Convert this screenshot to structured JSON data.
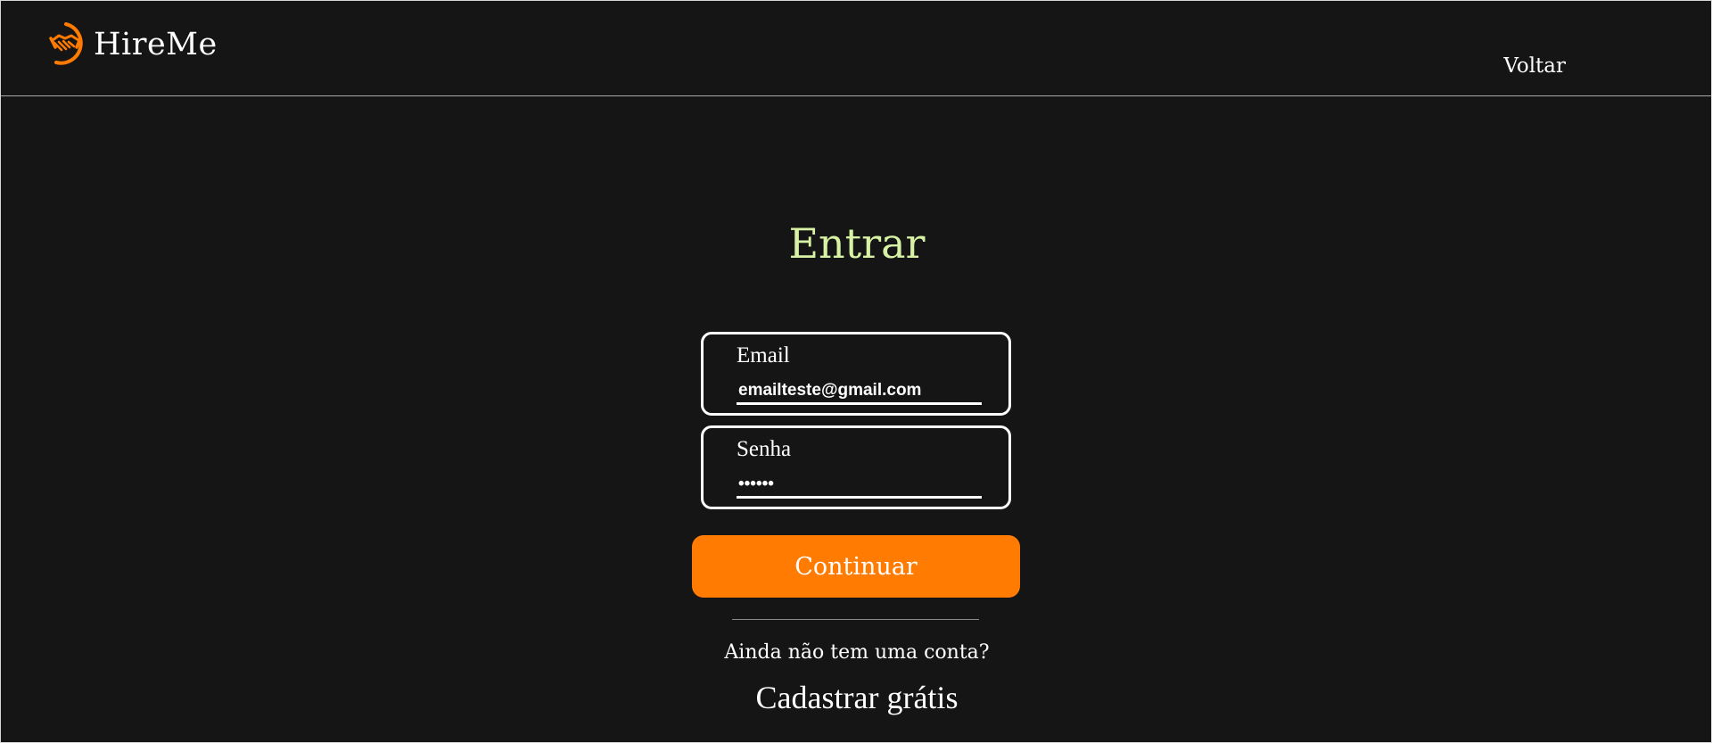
{
  "header": {
    "logo_text": "HireMe",
    "logo_icon": "handshake-icon",
    "back_link": "Voltar"
  },
  "login": {
    "title": "Entrar",
    "email": {
      "label": "Email",
      "value": "emailteste@gmail.com"
    },
    "password": {
      "label": "Senha",
      "value": "••••••"
    },
    "submit_label": "Continuar",
    "signup_prompt": "Ainda não tem uma conta?",
    "signup_link": "Cadastrar grátis"
  },
  "colors": {
    "background": "#151515",
    "accent": "#ff7b01",
    "title": "#d7f2a4",
    "text": "#ffffff"
  }
}
